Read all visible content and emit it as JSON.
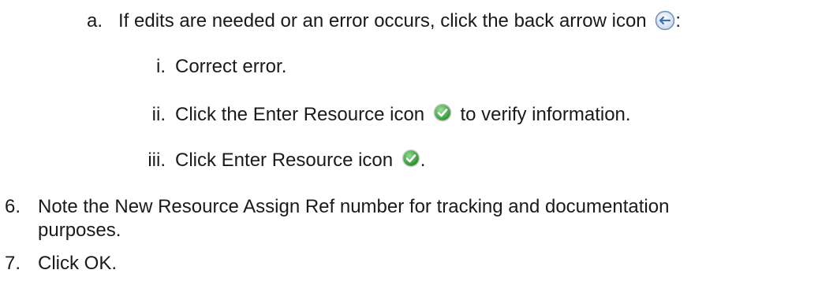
{
  "steps": {
    "sub_a": {
      "marker": "a.",
      "text_before_icon": "If edits are needed or an error occurs, click the back arrow icon",
      "text_after_icon": ":",
      "icon": "back-arrow-icon"
    },
    "sub_i": {
      "marker": "i.",
      "text": "Correct error."
    },
    "sub_ii": {
      "marker": "ii.",
      "text_before_icon": "Click the Enter Resource icon",
      "text_after_icon": "to verify information.",
      "icon": "enter-resource-check-icon"
    },
    "sub_iii": {
      "marker": "iii.",
      "text_before_icon": "Click Enter Resource icon",
      "text_after_icon": ".",
      "icon": "enter-resource-check-icon"
    },
    "step_6": {
      "marker": "6.",
      "line1": "Note the New Resource Assign Ref number for tracking and documentation",
      "line2": "purposes."
    },
    "step_7": {
      "marker": "7.",
      "text": "Click OK."
    }
  },
  "colors": {
    "text": "#1a1a1a",
    "check_green": "#3aa63a",
    "arrow_blue": "#3b6fb6"
  }
}
